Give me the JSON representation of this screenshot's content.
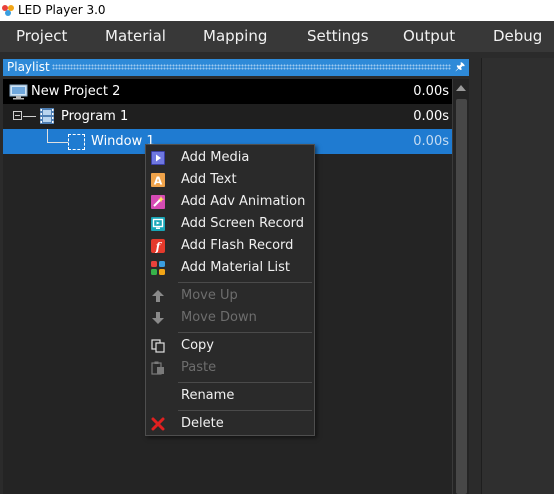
{
  "window": {
    "title": "LED Player 3.0"
  },
  "menu": [
    "Project",
    "Material",
    "Mapping",
    "Settings",
    "Output",
    "Debug"
  ],
  "playlist": {
    "title": "Playlist",
    "project": {
      "name": "New Project 2",
      "time": "0.00s"
    },
    "program": {
      "name": "Program  1",
      "time": "0.00s"
    },
    "window": {
      "name": "Window 1",
      "time": "0.00s"
    }
  },
  "context_menu": {
    "add_media": "Add Media",
    "add_text": "Add Text",
    "add_adv_animation": "Add Adv Animation",
    "add_screen_record": "Add Screen Record",
    "add_flash_record": "Add Flash Record",
    "add_material_list": "Add Material List",
    "move_up": "Move Up",
    "move_down": "Move Down",
    "copy": "Copy",
    "paste": "Paste",
    "rename": "Rename",
    "delete": "Delete"
  },
  "icons": {
    "app": "led-player-logo-icon",
    "pin": "pin-icon",
    "project": "monitor-icon",
    "program": "film-icon",
    "window": "window-frame-icon"
  },
  "colors": {
    "selection": "#1f7bd1",
    "header": "#2e8ad8",
    "delete": "#e02020"
  }
}
